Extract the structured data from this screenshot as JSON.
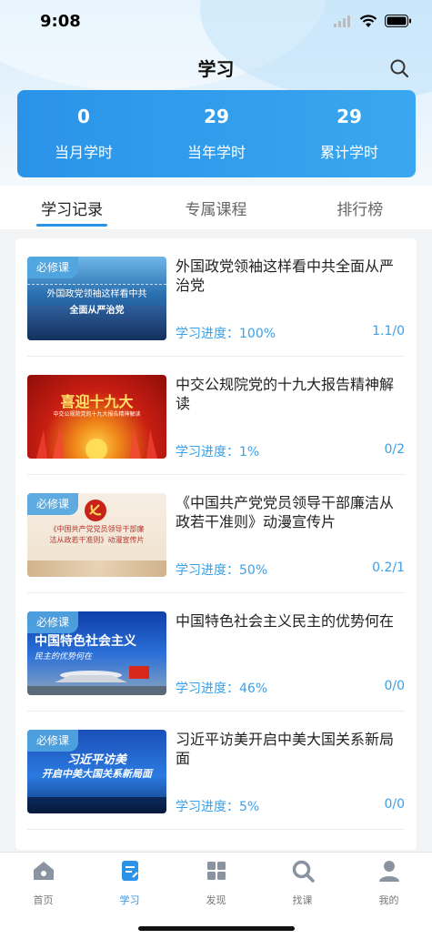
{
  "status": {
    "time": "9:08"
  },
  "header": {
    "title": "学习"
  },
  "stats": [
    {
      "value": "0",
      "label": "当月学时"
    },
    {
      "value": "29",
      "label": "当年学时"
    },
    {
      "value": "29",
      "label": "累计学时"
    }
  ],
  "tabs": [
    {
      "label": "学习记录",
      "active": true
    },
    {
      "label": "专属课程",
      "active": false
    },
    {
      "label": "排行榜",
      "active": false
    }
  ],
  "courses": [
    {
      "badge": "必修课",
      "thumb_line1": "外国政党领袖这样看中共",
      "thumb_line2": "全面从严治党",
      "title": "外国政党领袖这样看中共全面从严治党",
      "progress": "学习进度：100%",
      "score": "1.1/0"
    },
    {
      "badge": "",
      "thumb_line1": "喜迎十九大",
      "thumb_line2": "中交公规院党的十九大报告精神解读",
      "title": "中交公规院党的十九大报告精神解读",
      "progress": "学习进度：1%",
      "score": "0/2"
    },
    {
      "badge": "必修课",
      "thumb_line1": "《中国共产党党员领导干部廉",
      "thumb_line2": "洁从政若干准则》动漫宣传片",
      "title": "《中国共产党党员领导干部廉洁从政若干准则》动漫宣传片",
      "progress": "学习进度：50%",
      "score": "0.2/1"
    },
    {
      "badge": "必修课",
      "thumb_line1": "中国特色社会主义",
      "thumb_line2": "民主的优势何在",
      "title": "中国特色社会主义民主的优势何在",
      "progress": "学习进度：46%",
      "score": "0/0"
    },
    {
      "badge": "必修课",
      "thumb_line1": "习近平访美",
      "thumb_line2": "开启中美大国关系新局面",
      "title": "习近平访美开启中美大国关系新局面",
      "progress": "学习进度：5%",
      "score": "0/0"
    }
  ],
  "bottom_nav": [
    {
      "label": "首页",
      "icon": "home-icon",
      "active": false
    },
    {
      "label": "学习",
      "icon": "study-icon",
      "active": true
    },
    {
      "label": "发现",
      "icon": "discover-icon",
      "active": false
    },
    {
      "label": "找课",
      "icon": "find-course-icon",
      "active": false
    },
    {
      "label": "我的",
      "icon": "profile-icon",
      "active": false
    }
  ],
  "colors": {
    "accent": "#2a93e8",
    "progress": "#3aa0e8",
    "badge": "#50a5e1"
  }
}
